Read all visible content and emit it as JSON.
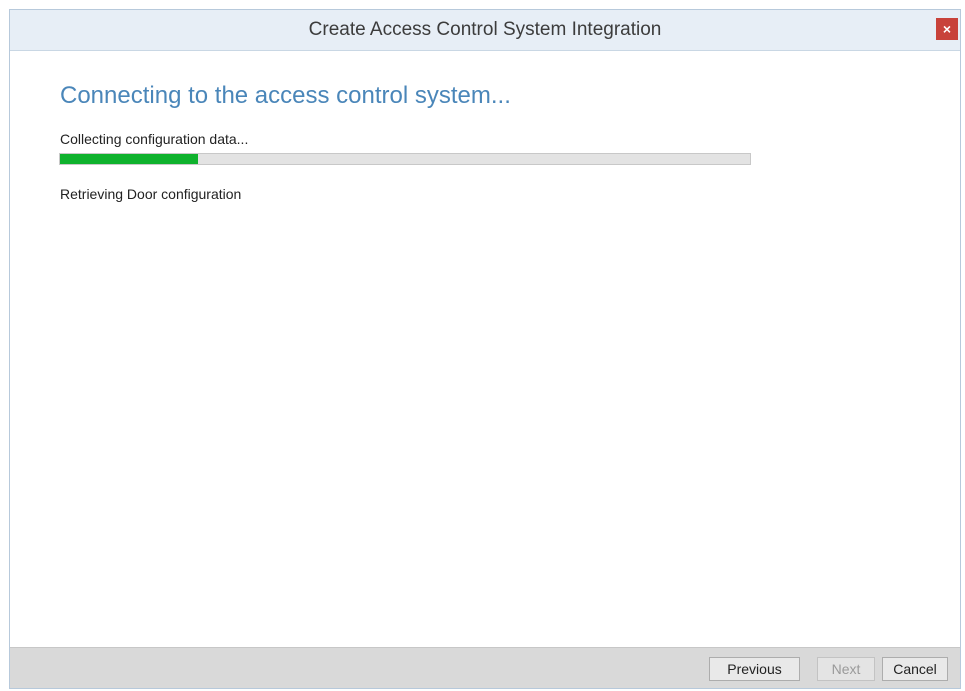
{
  "window": {
    "title": "Create Access Control System Integration",
    "close_label": "×"
  },
  "main": {
    "heading": "Connecting to the access control system...",
    "status": "Collecting configuration data...",
    "progress_fraction": 0.2,
    "detail": "Retrieving Door configuration"
  },
  "footer": {
    "previous_label": "Previous",
    "next_label": "Next",
    "next_enabled": false,
    "cancel_label": "Cancel"
  },
  "colors": {
    "heading": "#4a86b9",
    "progress_fill": "#0fb22d",
    "close_button": "#c8423a"
  }
}
